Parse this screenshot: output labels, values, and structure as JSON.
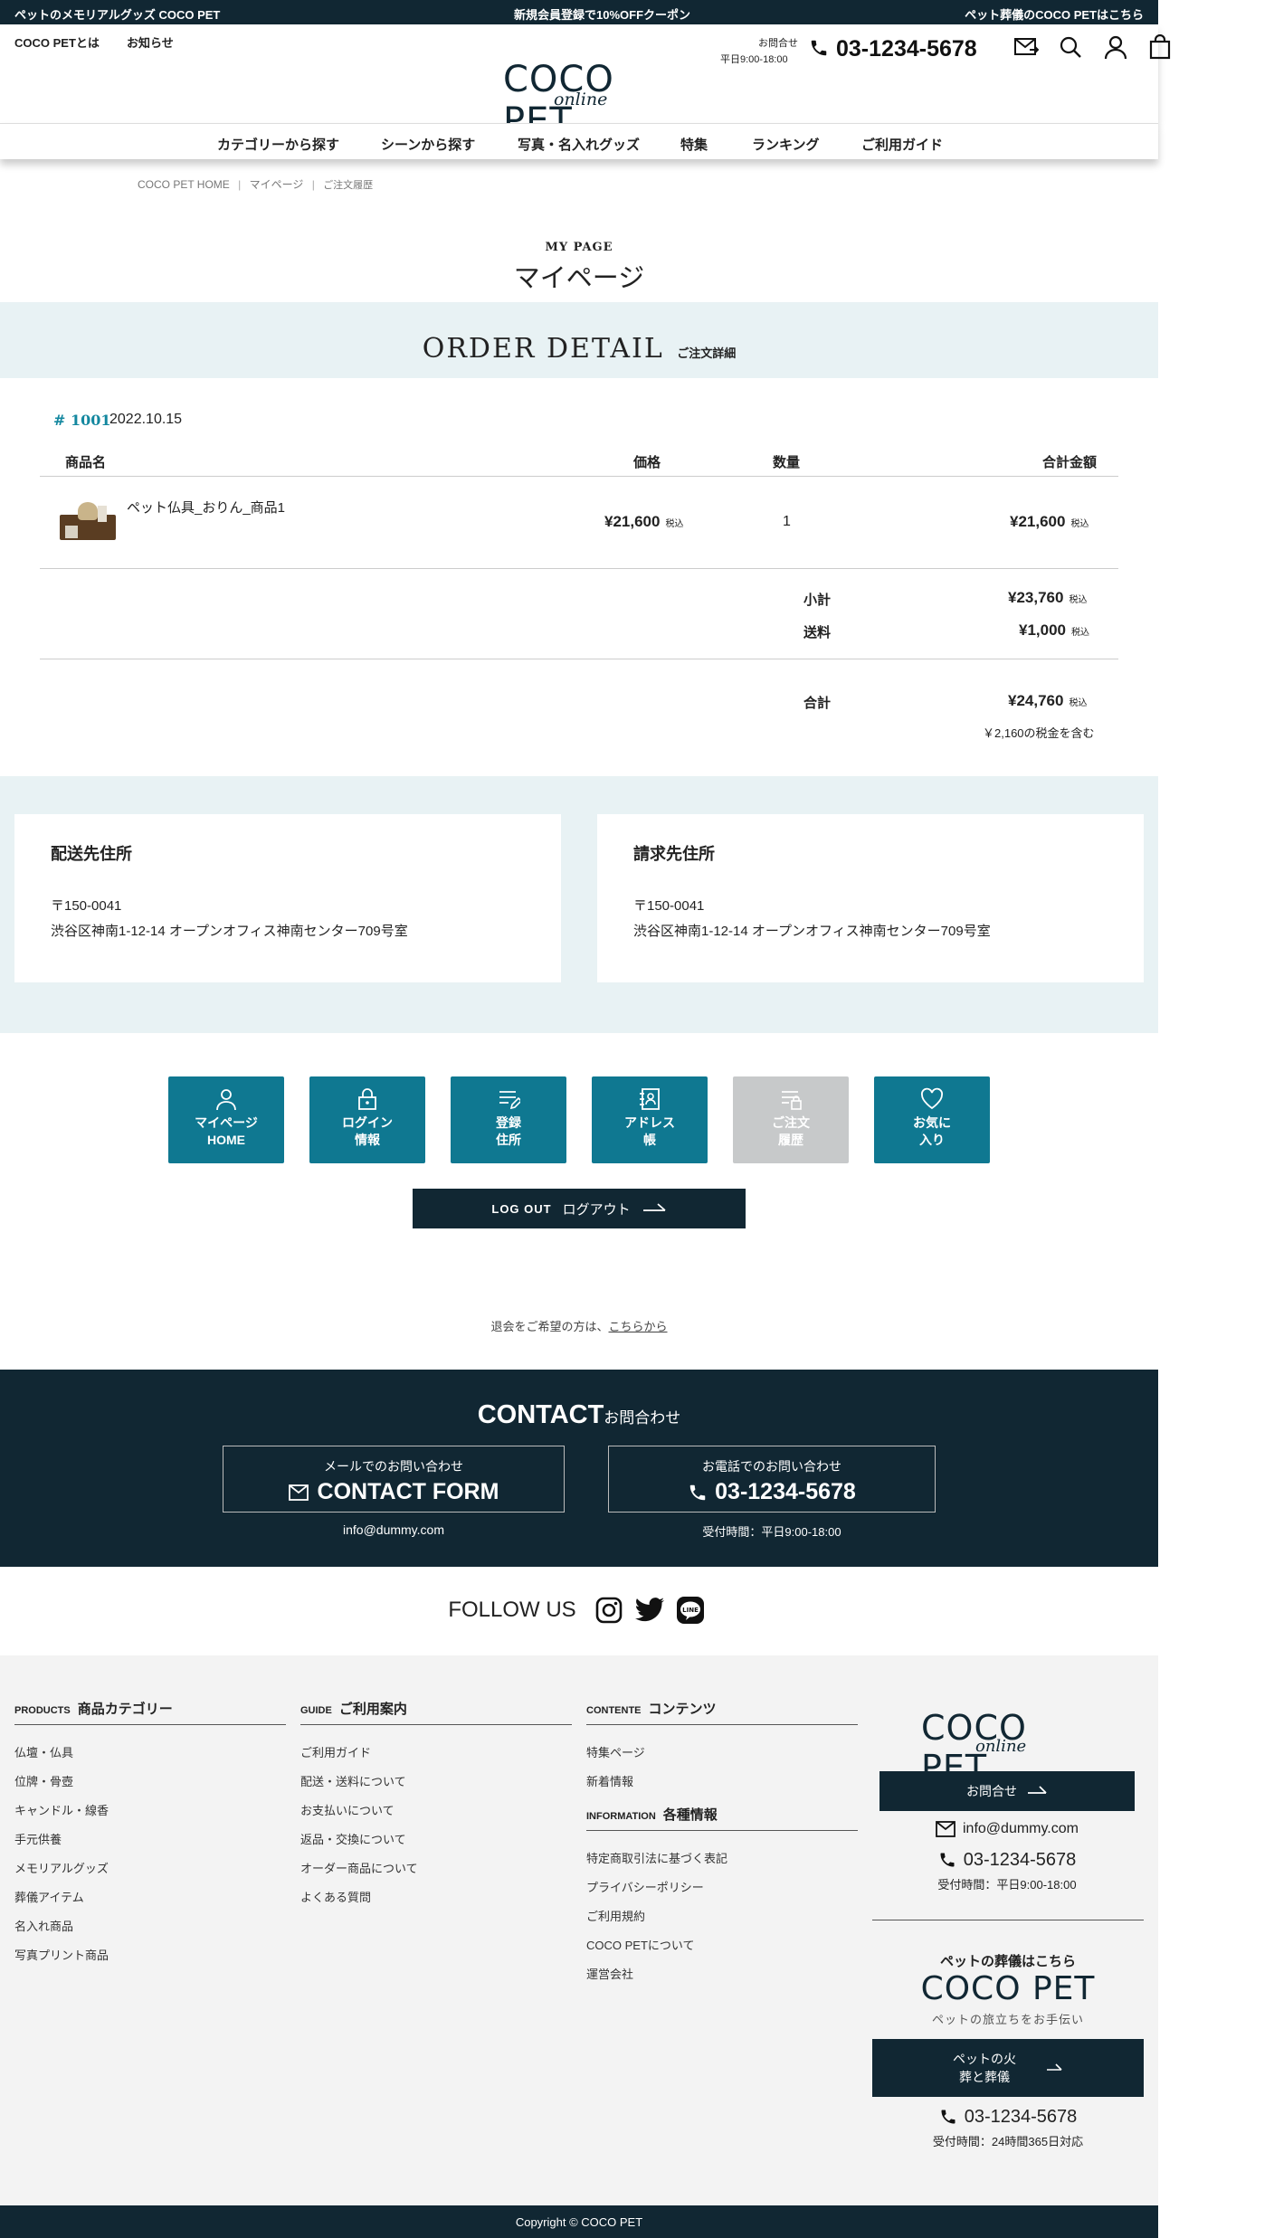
{
  "topbar": {
    "left": "ペットのメモリアルグッズ COCO PET",
    "center": "新規会員登録で10%OFFクーポン",
    "right": "ペット葬儀のCOCO PETはこちら"
  },
  "header": {
    "links": [
      "COCO PETとは",
      "お知らせ"
    ],
    "logo": "COCO PET",
    "logo_script": "online",
    "contact_label": "お問合せ",
    "contact_hours": "平日9:00-18:00",
    "phone": "03-1234-5678"
  },
  "nav": [
    "カテゴリーから探す",
    "シーンから探す",
    "写真・名入れグッズ",
    "特集",
    "ランキング",
    "ご利用ガイド"
  ],
  "breadcrumb": [
    "COCO PET HOME",
    "マイページ",
    "ご注文履歴"
  ],
  "page": {
    "sub": "MY PAGE",
    "title": "マイページ"
  },
  "section": {
    "title": "ORDER DETAIL",
    "sub": "ご注文詳細"
  },
  "order": {
    "number": "# 1001",
    "date": "2022.10.15",
    "headers": {
      "name": "商品名",
      "price": "価格",
      "qty": "数量",
      "total": "合計金額"
    },
    "item": {
      "name": "ペット仏具_おりん_商品1",
      "price": "¥21,600",
      "qty": "1",
      "total": "¥21,600"
    },
    "tax_label": "税込",
    "subtotal_label": "小計",
    "subtotal": "¥23,760",
    "shipping_label": "送料",
    "shipping": "¥1,000",
    "grand_label": "合計",
    "grand": "¥24,760",
    "tax_note": "￥2,160の税金を含む"
  },
  "addresses": {
    "shipping": {
      "title": "配送先住所",
      "zip": "〒150-0041",
      "addr": "渋谷区神南1-12-14 オープンオフィス神南センター709号室"
    },
    "billing": {
      "title": "請求先住所",
      "zip": "〒150-0041",
      "addr": "渋谷区神南1-12-14 オープンオフィス神南センター709号室"
    }
  },
  "mymenu": [
    {
      "l1": "マイページ",
      "l2": "HOME",
      "icon": "person-icon"
    },
    {
      "l1": "ログイン",
      "l2": "情報",
      "icon": "lock-icon"
    },
    {
      "l1": "登録",
      "l2": "住所",
      "icon": "edit-list-icon"
    },
    {
      "l1": "アドレス",
      "l2": "帳",
      "icon": "address-book-icon"
    },
    {
      "l1": "ご注文",
      "l2": "履歴",
      "icon": "order-history-icon"
    },
    {
      "l1": "お気に",
      "l2": "入り",
      "icon": "heart-icon"
    }
  ],
  "logout": {
    "en": "LOG OUT",
    "ja": "ログアウト"
  },
  "withdraw": {
    "text": "退会をご希望の方は、",
    "link": "こちらから"
  },
  "contact": {
    "title": "CONTACT",
    "title_ja": "お問合わせ",
    "mail_label": "メールでのお問い合わせ",
    "mail_btn": "CONTACT FORM",
    "mail_addr": "info@dummy.com",
    "tel_label": "お電話でのお問い合わせ",
    "tel": "03-1234-5678",
    "tel_hours": "受付時間：平日9:00-18:00"
  },
  "follow": {
    "label": "FOLLOW US"
  },
  "footer": {
    "products": {
      "en": "PRODUCTS",
      "ja": "商品カテゴリー",
      "items": [
        "仏壇・仏具",
        "位牌・骨壺",
        "キャンドル・線香",
        "手元供養",
        "メモリアルグッズ",
        "葬儀アイテム",
        "名入れ商品",
        "写真プリント商品"
      ]
    },
    "guide": {
      "en": "GUIDE",
      "ja": "ご利用案内",
      "items": [
        "ご利用ガイド",
        "配送・送料について",
        "お支払いについて",
        "返品・交換について",
        "オーダー商品について",
        "よくある質問"
      ]
    },
    "contents": {
      "en": "CONTENTE",
      "ja": "コンテンツ",
      "items": [
        "特集ページ",
        "新着情報"
      ]
    },
    "info": {
      "en": "INFORMATION",
      "ja": "各種情報",
      "items": [
        "特定商取引法に基づく表記",
        "プライバシーポリシー",
        "ご利用規約",
        "COCO PETについて",
        "運営会社"
      ]
    },
    "side": {
      "logo": "COCO PET",
      "logo_script": "online",
      "contact_btn": "お問合せ",
      "mail": "info@dummy.com",
      "tel": "03-1234-5678",
      "hours": "受付時間：平日9:00-18:00",
      "funeral_label": "ペットの葬儀はこちら",
      "funeral_logo": "COCO PET",
      "funeral_tagline": "ペットの旅立ちをお手伝い",
      "funeral_btn1": "ペットの火",
      "funeral_btn2": "葬と葬儀",
      "funeral_tel": "03-1234-5678",
      "funeral_hours": "受付時間：24時間365日対応"
    },
    "copyright": "Copyright © COCO PET"
  }
}
